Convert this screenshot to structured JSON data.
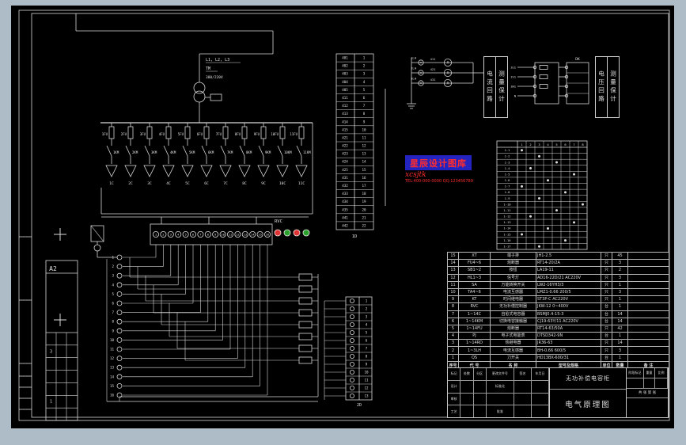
{
  "palette": {
    "page_bg": "#aebcc8",
    "canvas_bg": "#000000",
    "line": "#d9d9d9",
    "text": "#e0e0e0"
  },
  "sheet": {
    "size_label": "A2"
  },
  "incoming": {
    "phase_label": "L1, L2, L3",
    "transformer_label": "TM",
    "voltage_label": "380/220V"
  },
  "branches": [
    {
      "fu": "1FU",
      "km": "1KM",
      "c": "1C"
    },
    {
      "fu": "2FU",
      "km": "2KM",
      "c": "2C"
    },
    {
      "fu": "3FU",
      "km": "3KM",
      "c": "3C"
    },
    {
      "fu": "4FU",
      "km": "4KM",
      "c": "4C"
    },
    {
      "fu": "5FU",
      "km": "5KM",
      "c": "5C"
    },
    {
      "fu": "6FU",
      "km": "6KM",
      "c": "6C"
    },
    {
      "fu": "7FU",
      "km": "7KM",
      "c": "7C"
    },
    {
      "fu": "8FU",
      "km": "8KM",
      "c": "8C"
    },
    {
      "fu": "9FU",
      "km": "9KM",
      "c": "9C"
    },
    {
      "fu": "10FU",
      "km": "10KM",
      "c": "10C"
    },
    {
      "fu": "11FU",
      "km": "11KM",
      "c": "11C"
    }
  ],
  "controller": {
    "label": "RVC",
    "terminals": [
      "1",
      "2",
      "3",
      "4",
      "5",
      "6",
      "7",
      "8",
      "9",
      "10",
      "11",
      "12",
      "13",
      "14",
      "15",
      "16"
    ],
    "leds": [
      "#e03434",
      "#2ca02c",
      "#e03434",
      "#2ca02c"
    ]
  },
  "left_terminals": [
    "1",
    "2",
    "3",
    "4",
    "5",
    "6",
    "7",
    "8",
    "9",
    "10",
    "11",
    "12",
    "13",
    "14",
    "15",
    "16"
  ],
  "table_a": {
    "label": "1D",
    "wires": [
      "401",
      "402",
      "403",
      "404",
      "405",
      "411",
      "412",
      "413",
      "414",
      "415",
      "421",
      "422",
      "423",
      "424",
      "425",
      "431",
      "432",
      "433",
      "434",
      "435",
      "441",
      "442"
    ],
    "nums": [
      "1",
      "2",
      "3",
      "4",
      "5",
      "6",
      "7",
      "8",
      "9",
      "10",
      "11",
      "12",
      "13",
      "14",
      "15",
      "16",
      "17",
      "18",
      "19",
      "20",
      "21",
      "22"
    ]
  },
  "table_b": {
    "label": "2D",
    "nums": [
      "1",
      "2",
      "3",
      "4",
      "5",
      "6",
      "7",
      "8",
      "9",
      "10",
      "11",
      "12",
      "13"
    ]
  },
  "matrix": {
    "cols": [
      "1",
      "2",
      "3",
      "4",
      "5",
      "6",
      "7",
      "8"
    ],
    "rows": [
      "1-1",
      "1-2",
      "1-3",
      "1-4",
      "1-5",
      "1-6",
      "1-7",
      "1-8",
      "1-9",
      "1-10",
      "1-11",
      "1-12",
      "1-13",
      "1-14",
      "1-15",
      "1-16",
      "1-17"
    ],
    "marks": [
      [
        1,
        1
      ],
      [
        2,
        3
      ],
      [
        3,
        5
      ],
      [
        4,
        2
      ],
      [
        5,
        7
      ],
      [
        6,
        4
      ],
      [
        7,
        1
      ],
      [
        8,
        6
      ],
      [
        9,
        3
      ],
      [
        10,
        8
      ],
      [
        11,
        5
      ],
      [
        12,
        2
      ],
      [
        13,
        7
      ],
      [
        14,
        4
      ],
      [
        15,
        1
      ],
      [
        16,
        6
      ],
      [
        17,
        3
      ]
    ]
  },
  "ct": {
    "meter": "A",
    "rows": [
      {
        "name": "1LH",
        "wire": "411"
      },
      {
        "name": "2LH",
        "wire": "421"
      },
      {
        "name": "3LH",
        "wire": "431"
      }
    ],
    "vlabels": [
      "电流回路",
      "测量保计"
    ]
  },
  "pt": {
    "label": "DK",
    "wires": [
      "1U1",
      "1V1",
      "1W1",
      "N"
    ],
    "vlabels": [
      "电压回路",
      "测量保计"
    ]
  },
  "stamp": {
    "title": "星辰设计图库",
    "script": "xcsjtk",
    "contact": "TEL:400-000-0000 QQ:123456789",
    "box_color": "#2323c0",
    "text_color": "#ff2d2d"
  },
  "bom": {
    "headers": [
      "序号",
      "代 号",
      "名 称",
      "型号及规格",
      "单位",
      "数量",
      "备 注"
    ],
    "rows": [
      [
        "15",
        "XT",
        "端子排",
        "JH1-2.5",
        "只",
        "45",
        ""
      ],
      [
        "14",
        "FU4~6",
        "熔断器",
        "RT14-20/2A",
        "只",
        "3",
        ""
      ],
      [
        "13",
        "SB1~2",
        "按钮",
        "LA19-11",
        "只",
        "2",
        ""
      ],
      [
        "12",
        "HL1~3",
        "信号灯",
        "AD16-22D/21 AC220V",
        "只",
        "3",
        ""
      ],
      [
        "11",
        "SA",
        "万能转换开关",
        "LW2-16YH3/3",
        "只",
        "1",
        ""
      ],
      [
        "10",
        "TA4~6",
        "电流互感器",
        "LMZ1-0.66 200/5",
        "只",
        "3",
        ""
      ],
      [
        "9",
        "KT",
        "时间继电器",
        "ST3P-C AC220V",
        "只",
        "1",
        ""
      ],
      [
        "8",
        "RVC",
        "无功补偿控制器",
        "JKW-12 0~400V",
        "台",
        "1",
        ""
      ],
      [
        "7",
        "1~14C",
        "自愈式电容器",
        "BSMJ0.4-15-3",
        "台",
        "14",
        ""
      ],
      [
        "6",
        "1~14KM",
        "切换电容接触器",
        "CJ19-63Y/11 AC220V",
        "台",
        "14",
        ""
      ],
      [
        "5",
        "1~14FU",
        "熔断器",
        "RT14-63/50A",
        "只",
        "42",
        ""
      ],
      [
        "4",
        "PJ",
        "电子式电能表",
        "DTSD342-9N",
        "台",
        "1",
        ""
      ],
      [
        "3",
        "1~14RD",
        "热继电器",
        "JR36-63",
        "只",
        "14",
        ""
      ],
      [
        "2",
        "1~3LH",
        "电流互感器",
        "BH-0.66 600/5",
        "只",
        "3",
        ""
      ],
      [
        "1",
        "QS",
        "刀开关",
        "HD13BX-600/31",
        "台",
        "1",
        ""
      ]
    ]
  },
  "title_block": {
    "product": "无功补偿电容柜",
    "title": "电气原理图",
    "left_rows": [
      [
        "标记",
        "处数",
        "分区",
        "更改文件号",
        "签名",
        "年月日"
      ],
      [
        "设计",
        "",
        "",
        "标准化",
        "",
        ""
      ],
      [
        "审核",
        "",
        "",
        "",
        "",
        ""
      ],
      [
        "工艺",
        "",
        "",
        "批准",
        "",
        ""
      ]
    ],
    "right": {
      "labels": [
        "阶段标记",
        "重量",
        "比例"
      ],
      "sheets": "共 张 第 张"
    }
  },
  "revision": {
    "digits": [
      {
        "row": 1,
        "text": "3"
      },
      {
        "row": 5,
        "text": "1"
      }
    ]
  }
}
